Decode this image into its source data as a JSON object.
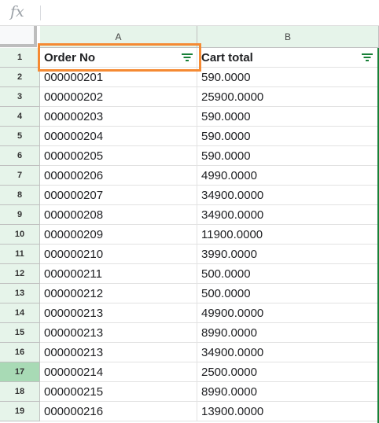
{
  "formula_bar": {
    "icon_label": "fx",
    "value": ""
  },
  "columns": [
    {
      "letter": "A"
    },
    {
      "letter": "B"
    }
  ],
  "header_row": {
    "row_number": "1",
    "col_a": "Order No",
    "col_b": "Cart total"
  },
  "rows": [
    {
      "row_number": "2",
      "order_no": "000000201",
      "cart_total": "590.0000"
    },
    {
      "row_number": "3",
      "order_no": "000000202",
      "cart_total": "25900.0000"
    },
    {
      "row_number": "4",
      "order_no": "000000203",
      "cart_total": "590.0000"
    },
    {
      "row_number": "5",
      "order_no": "000000204",
      "cart_total": "590.0000"
    },
    {
      "row_number": "6",
      "order_no": "000000205",
      "cart_total": "590.0000"
    },
    {
      "row_number": "7",
      "order_no": "000000206",
      "cart_total": "4990.0000"
    },
    {
      "row_number": "8",
      "order_no": "000000207",
      "cart_total": "34900.0000"
    },
    {
      "row_number": "9",
      "order_no": "000000208",
      "cart_total": "34900.0000"
    },
    {
      "row_number": "10",
      "order_no": "000000209",
      "cart_total": "11900.0000"
    },
    {
      "row_number": "11",
      "order_no": "000000210",
      "cart_total": "3990.0000"
    },
    {
      "row_number": "12",
      "order_no": "000000211",
      "cart_total": "500.0000"
    },
    {
      "row_number": "13",
      "order_no": "000000212",
      "cart_total": "500.0000"
    },
    {
      "row_number": "14",
      "order_no": "000000213",
      "cart_total": "49900.0000"
    },
    {
      "row_number": "15",
      "order_no": "000000213",
      "cart_total": "8990.0000"
    },
    {
      "row_number": "16",
      "order_no": "000000213",
      "cart_total": "34900.0000"
    },
    {
      "row_number": "17",
      "order_no": "000000214",
      "cart_total": "2500.0000"
    },
    {
      "row_number": "18",
      "order_no": "000000215",
      "cart_total": "8990.0000"
    },
    {
      "row_number": "19",
      "order_no": "000000216",
      "cart_total": "13900.0000"
    }
  ],
  "active_row": "17",
  "colors": {
    "accent_green": "#188038",
    "highlight_orange": "#f58a33",
    "header_bg": "#e6f4ea"
  },
  "icons": {
    "filter": "filter-icon",
    "formula": "fx-icon"
  }
}
